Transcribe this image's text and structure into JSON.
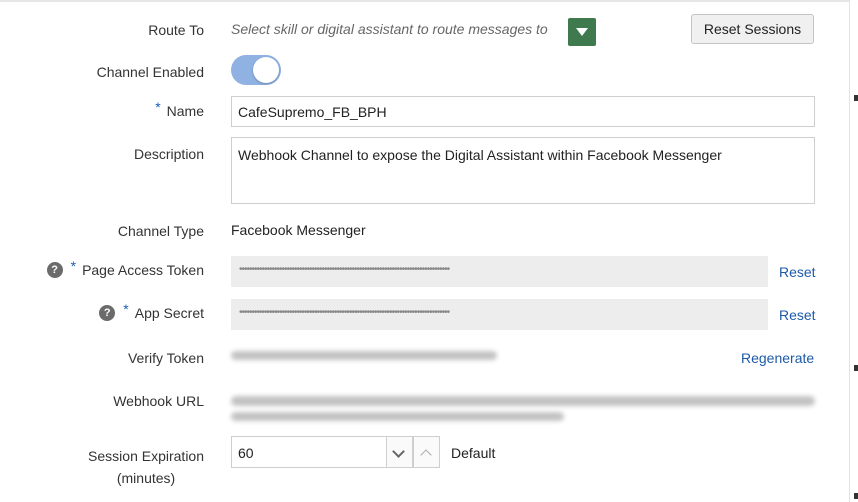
{
  "route_to": {
    "label": "Route To",
    "placeholder": "Select skill or digital assistant to route messages to",
    "dropdown_icon": "chevron-down-icon"
  },
  "reset_sessions_label": "Reset Sessions",
  "channel_enabled": {
    "label": "Channel Enabled",
    "value": true
  },
  "name": {
    "required_mark": "*",
    "label": "Name",
    "value": "CafeSupremo_FB_BPH"
  },
  "description": {
    "label": "Description",
    "value": "Webhook Channel to expose the Digital Assistant within Facebook Messenger"
  },
  "channel_type": {
    "label": "Channel Type",
    "value": "Facebook Messenger"
  },
  "page_access_token": {
    "help_icon": "question-icon",
    "help_glyph": "?",
    "required_mark": "*",
    "label": "Page Access Token",
    "masked_value": "••••••••••••••••••••••••••••••••••••••••••••••••••••••••••••••••••••••••••••••••••••",
    "reset_label": "Reset"
  },
  "app_secret": {
    "help_icon": "question-icon",
    "help_glyph": "?",
    "required_mark": "*",
    "label": "App Secret",
    "masked_value": "••••••••••••••••••••••••••••••••••••••••••••••••••••••••••••••••••••••••••••••••••••",
    "reset_label": "Reset"
  },
  "verify_token": {
    "label": "Verify Token",
    "regenerate_label": "Regenerate"
  },
  "webhook_url": {
    "label": "Webhook URL"
  },
  "session_expiration": {
    "label_line1": "Session Expiration",
    "label_line2": "(minutes)",
    "value": "60",
    "default_label": "Default"
  },
  "colors": {
    "accent_blue": "#1d5aa8",
    "toggle_on": "#8fb2e3",
    "dropdown_green": "#3f7a4f"
  }
}
